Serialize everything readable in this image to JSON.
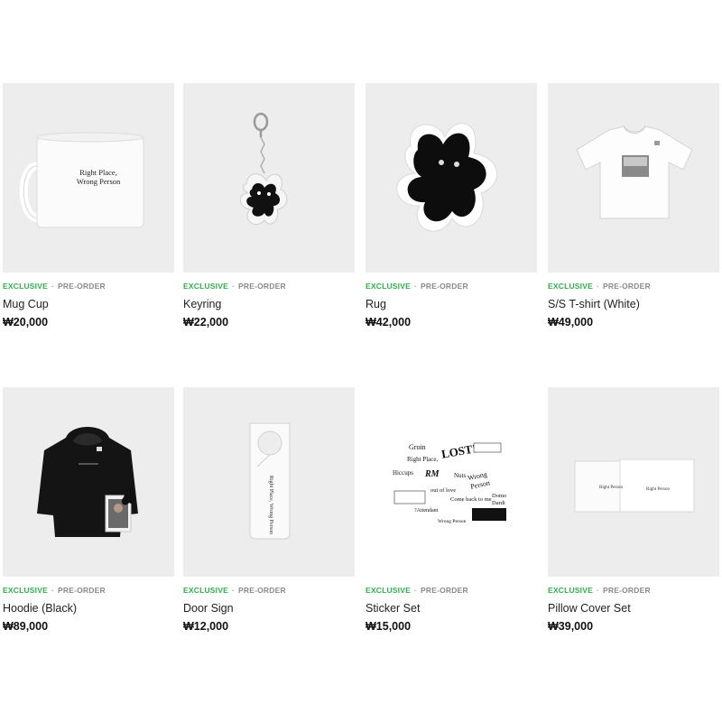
{
  "colors": {
    "exclusive": "#2fb24c",
    "preorder": "#8a8a8a",
    "thumb_bg": "#ededed"
  },
  "products": [
    {
      "tag_exclusive": "EXCLUSIVE",
      "tag_separator": "·",
      "tag_preorder": "PRE-ORDER",
      "name": "Mug Cup",
      "price": "₩20,000",
      "image_text": [
        "Right Place,",
        "Wrong Person"
      ]
    },
    {
      "tag_exclusive": "EXCLUSIVE",
      "tag_separator": "·",
      "tag_preorder": "PRE-ORDER",
      "name": "Keyring",
      "price": "₩22,000"
    },
    {
      "tag_exclusive": "EXCLUSIVE",
      "tag_separator": "·",
      "tag_preorder": "PRE-ORDER",
      "name": "Rug",
      "price": "₩42,000"
    },
    {
      "tag_exclusive": "EXCLUSIVE",
      "tag_separator": "·",
      "tag_preorder": "PRE-ORDER",
      "name": "S/S T-shirt (White)",
      "price": "₩49,000"
    },
    {
      "tag_exclusive": "EXCLUSIVE",
      "tag_separator": "·",
      "tag_preorder": "PRE-ORDER",
      "name": "Hoodie (Black)",
      "price": "₩89,000"
    },
    {
      "tag_exclusive": "EXCLUSIVE",
      "tag_separator": "·",
      "tag_preorder": "PRE-ORDER",
      "name": "Door Sign",
      "price": "₩12,000",
      "image_text": [
        "Right Place, Wrong Person"
      ]
    },
    {
      "tag_exclusive": "EXCLUSIVE",
      "tag_separator": "·",
      "tag_preorder": "PRE-ORDER",
      "name": "Sticker Set",
      "price": "₩15,000",
      "image_text": [
        "Groin",
        "LOST!",
        "Right Place,",
        "RM",
        "Nuts",
        "Hiccups",
        "Wrong",
        "Person",
        "out of love",
        "Come back to me",
        "Domo",
        "Dardi",
        "?Attendant",
        "Wrong Person"
      ]
    },
    {
      "tag_exclusive": "EXCLUSIVE",
      "tag_separator": "·",
      "tag_preorder": "PRE-ORDER",
      "name": "Pillow Cover Set",
      "price": "₩39,000",
      "image_text": [
        "Right Person",
        "Right Person"
      ]
    }
  ]
}
